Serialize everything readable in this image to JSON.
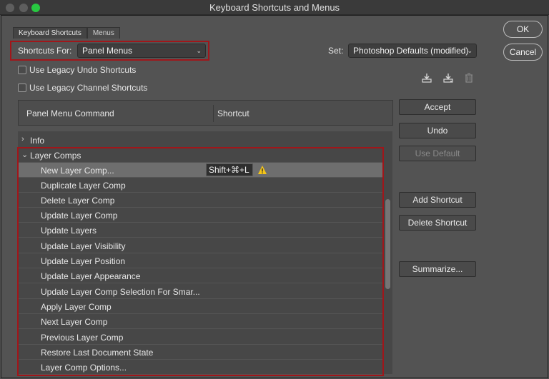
{
  "window": {
    "title": "Keyboard Shortcuts and Menus"
  },
  "tabs": [
    {
      "label": "Keyboard Shortcuts",
      "active": true
    },
    {
      "label": "Menus",
      "active": false
    }
  ],
  "shortcuts_for": {
    "label": "Shortcuts For:",
    "value": "Panel Menus"
  },
  "set": {
    "label": "Set:",
    "value": "Photoshop Defaults (modified)"
  },
  "options": [
    {
      "label": "Use Legacy Undo Shortcuts",
      "checked": false
    },
    {
      "label": "Use Legacy Channel Shortcuts",
      "checked": false
    }
  ],
  "table": {
    "col_command": "Panel Menu Command",
    "col_shortcut": "Shortcut"
  },
  "groups": {
    "info": {
      "label": "Info",
      "expanded": false
    },
    "layer_comps": {
      "label": "Layer Comps",
      "expanded": true
    }
  },
  "rows": [
    {
      "label": "New Layer Comp...",
      "shortcut": "Shift+⌘+L",
      "warning": true,
      "selected": true
    },
    {
      "label": "Duplicate Layer Comp"
    },
    {
      "label": "Delete Layer Comp"
    },
    {
      "label": "Update Layer Comp"
    },
    {
      "label": "Update Layers"
    },
    {
      "label": "Update Layer Visibility"
    },
    {
      "label": "Update Layer Position"
    },
    {
      "label": "Update Layer Appearance"
    },
    {
      "label": "Update Layer Comp Selection For Smar..."
    },
    {
      "label": "Apply Layer Comp"
    },
    {
      "label": "Next Layer Comp"
    },
    {
      "label": "Previous Layer Comp"
    },
    {
      "label": "Restore Last Document State"
    },
    {
      "label": "Layer Comp Options..."
    }
  ],
  "buttons": {
    "ok": "OK",
    "cancel": "Cancel",
    "accept": "Accept",
    "undo": "Undo",
    "use_default": "Use Default",
    "add_shortcut": "Add Shortcut",
    "delete_shortcut": "Delete Shortcut",
    "summarize": "Summarize..."
  },
  "icons": [
    "save-set-icon",
    "save-as-set-icon",
    "delete-set-icon",
    "warning-icon"
  ],
  "colors": {
    "highlight": "#a0161a",
    "warning": "#f5c518"
  }
}
